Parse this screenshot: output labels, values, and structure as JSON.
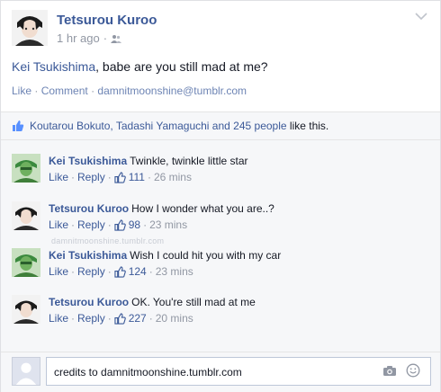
{
  "post": {
    "author": "Tetsurou Kuroo",
    "time": "1 hr ago",
    "separator": "·",
    "mention": "Kei Tsukishima",
    "message": ", babe are you still mad at me?",
    "actions": {
      "like": "Like",
      "comment": "Comment",
      "source": "damnitmoonshine@tumblr.com",
      "sep": "·"
    },
    "likes": {
      "names": "Koutarou Bokuto, Tadashi Yamaguchi and 245 people",
      "suffix": "like this."
    }
  },
  "comments": [
    {
      "author": "Kei Tsukishima",
      "text": "Twinkle, twinkle little star",
      "like": "Like",
      "reply": "Reply",
      "likes": "111",
      "time": "26 mins",
      "avatar": "tsukishima"
    },
    {
      "author": "Tetsurou Kuroo",
      "text": "How I wonder what you are..?",
      "like": "Like",
      "reply": "Reply",
      "likes": "98",
      "time": "23 mins",
      "avatar": "kuroo"
    },
    {
      "author": "Kei Tsukishima",
      "text": "Wish I could hit you with my car",
      "like": "Like",
      "reply": "Reply",
      "likes": "124",
      "time": "23 mins",
      "avatar": "tsukishima"
    },
    {
      "author": "Tetsurou Kuroo",
      "text": "OK. You're still mad at me",
      "like": "Like",
      "reply": "Reply",
      "likes": "227",
      "time": "20 mins",
      "avatar": "kuroo"
    }
  ],
  "watermark": "damnitmoonshine.tumblr.com",
  "composer": {
    "value": "credits to damnitmoonshine.tumblr.com"
  },
  "colors": {
    "link": "#3b5998",
    "muted": "#9197a3",
    "panel": "#f6f7f9"
  },
  "icons": [
    "friends-icon",
    "chevron-down-icon",
    "thumbs-up-icon",
    "camera-icon",
    "smiley-icon"
  ]
}
